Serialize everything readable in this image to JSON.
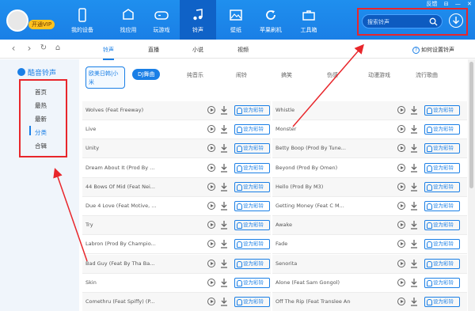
{
  "user": {
    "vip_label": "开通VIP"
  },
  "nav": [
    {
      "label": "我的设备",
      "icon": "phone-icon"
    },
    {
      "label": "找应用",
      "icon": "apps-icon"
    },
    {
      "label": "玩游戏",
      "icon": "gamepad-icon"
    },
    {
      "label": "铃声",
      "icon": "music-icon",
      "active": true
    },
    {
      "label": "壁纸",
      "icon": "wallpaper-icon"
    },
    {
      "label": "苹果刷机",
      "icon": "refresh-icon"
    },
    {
      "label": "工具箱",
      "icon": "toolbox-icon"
    }
  ],
  "window": {
    "feedback": "反馈",
    "controls": [
      "⊟",
      "—",
      "✕"
    ]
  },
  "search": {
    "placeholder": "搜索铃声"
  },
  "content_tabs": [
    "铃声",
    "直播",
    "小说",
    "视频"
  ],
  "active_tab": "铃声",
  "help": {
    "label": "如何设置铃声",
    "icon": "question-icon"
  },
  "sidebar": {
    "title": "酷音铃声",
    "items": [
      "首页",
      "最热",
      "最新",
      "分类",
      "合辑"
    ],
    "active": "分类"
  },
  "tags": [
    "欧美日韩|小米",
    "DJ舞曲",
    "纯音乐",
    "闹铃",
    "搞笑",
    "伤感",
    "动漫游戏",
    "流行歌曲"
  ],
  "active_tag": "DJ舞曲",
  "set_ringtone_label": "设为彩铃",
  "songs_left": [
    "Wolves (Feat Freeway)",
    "Live",
    "Unity",
    "Dream About It (Prod By ...",
    "44 Bows Of Mid (Feat Nei...",
    "Due 4 Love (Feat Motive, ...",
    "Try",
    "Labron (Prod By Champio...",
    "Bad Guy (Feat By Tha Ba...",
    "Skin",
    "Comethru (Feat Spiffy) (P..."
  ],
  "songs_right": [
    "Whistle",
    "Monster",
    "Betty Boop (Prod By Tune...",
    "Beyond (Prod By Omen)",
    "Hello (Prod By M3)",
    "Getting Money (Feat C M...",
    "Awake",
    "Fade",
    "Senorita",
    "Alone (Feat Sam Gongol)",
    "Off The Rip (Feat Translee And ..."
  ],
  "colors": {
    "primary": "#1a7fe6",
    "nav_active": "#0f62c7",
    "annotation": "#e8262b",
    "vip": "#ffc21f"
  }
}
